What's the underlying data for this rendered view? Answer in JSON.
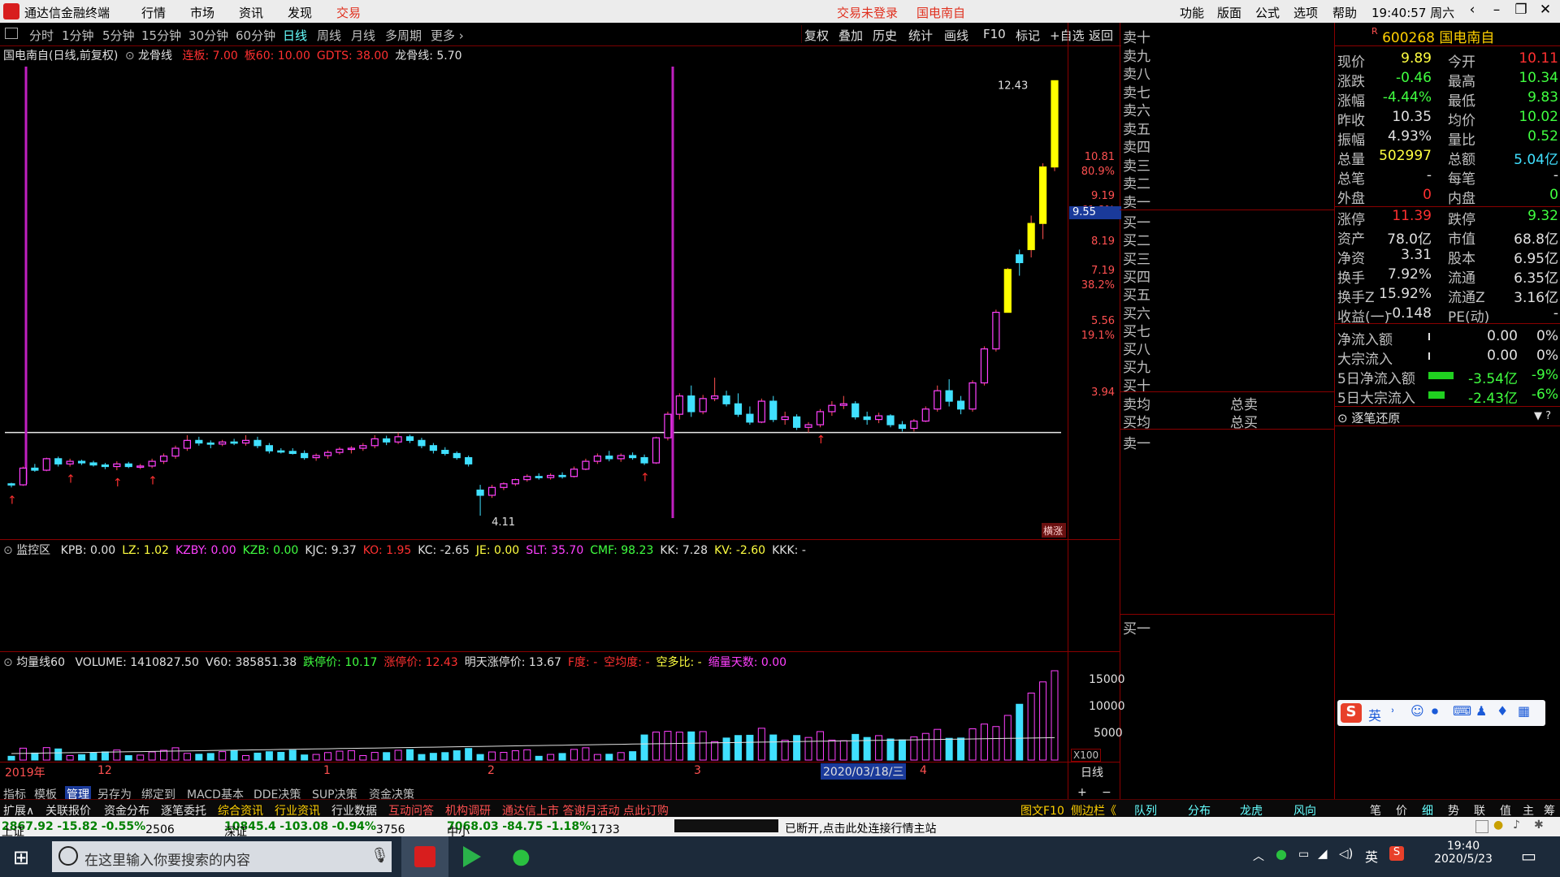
{
  "app": {
    "title": "通达信金融终端",
    "menu": [
      "行情",
      "市场",
      "资讯",
      "发现",
      "交易"
    ],
    "trade_status": "交易未登录",
    "stock_short": "国电南自",
    "right_menu": [
      "功能",
      "版面",
      "公式",
      "选项",
      "帮助"
    ],
    "clock": "19:40:57",
    "weekday": "周六"
  },
  "period_bar": {
    "periods": [
      "分时",
      "1分钟",
      "5分钟",
      "15分钟",
      "30分钟",
      "60分钟",
      "日线",
      "周线",
      "月线",
      "多周期",
      "更多"
    ],
    "active": "日线",
    "tools": [
      "复权",
      "叠加",
      "历史",
      "统计",
      "画线",
      "F10",
      "标记",
      "+自选",
      "返回"
    ]
  },
  "main_chart": {
    "header_name": "国电南自(日线,前复权)",
    "indicator_name": "龙骨线",
    "params": [
      {
        "k": "连板",
        "v": "7.00",
        "color": "#ff3030"
      },
      {
        "k": "板60",
        "v": "10.00",
        "color": "#ff3030"
      },
      {
        "k": "GDTS",
        "v": "38.00",
        "color": "#ff3030"
      },
      {
        "k": "龙骨线",
        "v": "5.70",
        "color": "#e0e0e0"
      }
    ],
    "price_labels": [
      "10.81",
      "80.9%",
      "9.19",
      "61.8%",
      "8.19",
      "7.19",
      "38.2%",
      "5.56",
      "19.1%",
      "3.94"
    ],
    "current_price_tag": "9.55",
    "high_label": "12.43",
    "low_label": "4.11",
    "badge": "横涨"
  },
  "chart_data": {
    "type": "candlestick",
    "y_range": [
      3.94,
      12.7
    ],
    "support_line": 5.7,
    "candles": [
      [
        4.72,
        4.74,
        4.65,
        4.7
      ],
      [
        4.7,
        5.05,
        4.68,
        5.02
      ],
      [
        5.02,
        5.1,
        4.95,
        4.98
      ],
      [
        4.98,
        5.22,
        4.96,
        5.2
      ],
      [
        5.2,
        5.24,
        5.05,
        5.1
      ],
      [
        5.1,
        5.2,
        5.05,
        5.15
      ],
      [
        5.15,
        5.18,
        5.08,
        5.12
      ],
      [
        5.12,
        5.16,
        5.05,
        5.08
      ],
      [
        5.08,
        5.12,
        5.0,
        5.05
      ],
      [
        5.05,
        5.15,
        4.98,
        5.1
      ],
      [
        5.1,
        5.14,
        5.02,
        5.05
      ],
      [
        5.05,
        5.1,
        5.0,
        5.06
      ],
      [
        5.06,
        5.2,
        5.02,
        5.15
      ],
      [
        5.15,
        5.3,
        5.1,
        5.25
      ],
      [
        5.25,
        5.45,
        5.2,
        5.4
      ],
      [
        5.4,
        5.65,
        5.35,
        5.55
      ],
      [
        5.55,
        5.62,
        5.45,
        5.5
      ],
      [
        5.5,
        5.55,
        5.4,
        5.48
      ],
      [
        5.48,
        5.56,
        5.44,
        5.52
      ],
      [
        5.52,
        5.58,
        5.46,
        5.5
      ],
      [
        5.5,
        5.65,
        5.45,
        5.55
      ],
      [
        5.55,
        5.62,
        5.4,
        5.45
      ],
      [
        5.45,
        5.5,
        5.3,
        5.35
      ],
      [
        5.35,
        5.4,
        5.3,
        5.34
      ],
      [
        5.34,
        5.4,
        5.28,
        5.3
      ],
      [
        5.3,
        5.36,
        5.18,
        5.22
      ],
      [
        5.22,
        5.3,
        5.16,
        5.26
      ],
      [
        5.26,
        5.36,
        5.2,
        5.32
      ],
      [
        5.32,
        5.42,
        5.28,
        5.38
      ],
      [
        5.38,
        5.44,
        5.3,
        5.4
      ],
      [
        5.4,
        5.5,
        5.35,
        5.45
      ],
      [
        5.45,
        5.65,
        5.4,
        5.58
      ],
      [
        5.58,
        5.64,
        5.46,
        5.52
      ],
      [
        5.52,
        5.7,
        5.48,
        5.62
      ],
      [
        5.62,
        5.66,
        5.5,
        5.55
      ],
      [
        5.55,
        5.6,
        5.4,
        5.45
      ],
      [
        5.45,
        5.5,
        5.3,
        5.36
      ],
      [
        5.36,
        5.42,
        5.26,
        5.3
      ],
      [
        5.3,
        5.34,
        5.18,
        5.22
      ],
      [
        5.22,
        5.26,
        5.05,
        5.1
      ],
      [
        4.6,
        4.7,
        4.11,
        4.5
      ],
      [
        4.5,
        4.7,
        4.45,
        4.65
      ],
      [
        4.65,
        4.75,
        4.6,
        4.72
      ],
      [
        4.72,
        4.82,
        4.68,
        4.8
      ],
      [
        4.8,
        4.9,
        4.76,
        4.86
      ],
      [
        4.86,
        4.92,
        4.8,
        4.84
      ],
      [
        4.84,
        4.92,
        4.8,
        4.88
      ],
      [
        4.88,
        4.94,
        4.82,
        4.86
      ],
      [
        4.86,
        5.05,
        4.84,
        5.0
      ],
      [
        5.0,
        5.2,
        4.98,
        5.15
      ],
      [
        5.15,
        5.3,
        5.1,
        5.25
      ],
      [
        5.25,
        5.35,
        5.15,
        5.2
      ],
      [
        5.2,
        5.3,
        5.14,
        5.26
      ],
      [
        5.26,
        5.32,
        5.18,
        5.22
      ],
      [
        5.22,
        5.28,
        5.08,
        5.12
      ],
      [
        5.12,
        5.62,
        5.1,
        5.6
      ],
      [
        5.6,
        6.1,
        5.55,
        6.05
      ],
      [
        6.05,
        6.45,
        5.95,
        6.4
      ],
      [
        6.4,
        6.6,
        6.0,
        6.1
      ],
      [
        6.1,
        6.42,
        6.05,
        6.35
      ],
      [
        6.35,
        6.75,
        6.3,
        6.4
      ],
      [
        6.4,
        6.5,
        6.2,
        6.25
      ],
      [
        6.25,
        6.45,
        6.0,
        6.05
      ],
      [
        6.05,
        6.2,
        5.85,
        5.9
      ],
      [
        5.9,
        6.35,
        5.88,
        6.3
      ],
      [
        6.3,
        6.4,
        5.9,
        5.95
      ],
      [
        5.95,
        6.1,
        5.85,
        6.0
      ],
      [
        6.0,
        6.05,
        5.75,
        5.8
      ],
      [
        5.8,
        5.9,
        5.7,
        5.85
      ],
      [
        5.85,
        6.15,
        5.8,
        6.1
      ],
      [
        6.1,
        6.3,
        6.02,
        6.22
      ],
      [
        6.22,
        6.4,
        6.15,
        6.25
      ],
      [
        6.25,
        6.3,
        5.95,
        6.0
      ],
      [
        6.0,
        6.1,
        5.85,
        5.95
      ],
      [
        5.95,
        6.08,
        5.88,
        6.02
      ],
      [
        6.02,
        6.05,
        5.8,
        5.85
      ],
      [
        5.85,
        5.92,
        5.72,
        5.78
      ],
      [
        5.78,
        5.96,
        5.72,
        5.92
      ],
      [
        5.92,
        6.2,
        5.9,
        6.15
      ],
      [
        6.15,
        6.6,
        6.1,
        6.5
      ],
      [
        6.5,
        6.72,
        6.2,
        6.3
      ],
      [
        6.3,
        6.4,
        6.05,
        6.15
      ],
      [
        6.15,
        6.7,
        6.1,
        6.65
      ],
      [
        6.65,
        7.35,
        6.6,
        7.3
      ],
      [
        7.3,
        8.05,
        7.25,
        8.0
      ],
      [
        8.0,
        8.85,
        8.0,
        8.82
      ],
      [
        9.1,
        9.2,
        8.7,
        8.95
      ],
      [
        9.2,
        9.85,
        9.05,
        9.7
      ],
      [
        9.7,
        10.85,
        9.4,
        10.78
      ],
      [
        10.78,
        12.43,
        10.7,
        12.43
      ]
    ]
  },
  "monitor_pane": {
    "title": "监控区",
    "items": [
      {
        "k": "KPB",
        "v": "0.00",
        "color": "#e0e0e0"
      },
      {
        "k": "LZ",
        "v": "1.02",
        "color": "#ffff40"
      },
      {
        "k": "KZBY",
        "v": "0.00",
        "color": "#ff40ff"
      },
      {
        "k": "KZB",
        "v": "0.00",
        "color": "#40ff40"
      },
      {
        "k": "KJC",
        "v": "9.37",
        "color": "#e0e0e0"
      },
      {
        "k": "KO",
        "v": "1.95",
        "color": "#ff3030"
      },
      {
        "k": "KC",
        "v": "-2.65",
        "color": "#e0e0e0"
      },
      {
        "k": "JE",
        "v": "0.00",
        "color": "#ffff40"
      },
      {
        "k": "SLT",
        "v": "35.70",
        "color": "#ff40ff"
      },
      {
        "k": "CMF",
        "v": "98.23",
        "color": "#40ff40"
      },
      {
        "k": "KK",
        "v": "7.28",
        "color": "#e0e0e0"
      },
      {
        "k": "KV",
        "v": "-2.60",
        "color": "#ffff40"
      },
      {
        "k": "KKK",
        "v": "-",
        "color": "#e0e0e0"
      }
    ]
  },
  "volume_pane": {
    "title": "均量线60",
    "items": [
      {
        "k": "VOLUME",
        "v": "1410827.50",
        "color": "#e0e0e0"
      },
      {
        "k": "V60",
        "v": "385851.38",
        "color": "#e0e0e0"
      },
      {
        "k": "跌停价",
        "v": "10.17",
        "color": "#40ff40"
      },
      {
        "k": "涨停价",
        "v": "12.43",
        "color": "#ff3030"
      },
      {
        "k": "明天涨停价",
        "v": "13.67",
        "color": "#e0e0e0"
      },
      {
        "k": "F度",
        "v": "-",
        "color": "#ff3030"
      },
      {
        "k": "空均度",
        "v": "-",
        "color": "#ff3030"
      },
      {
        "k": "空多比",
        "v": "-",
        "color": "#ffff40"
      },
      {
        "k": "缩量天数",
        "v": "0.00",
        "color": "#ff40ff"
      }
    ],
    "y_labels": [
      "15000",
      "10000",
      "5000"
    ],
    "unit": "X100"
  },
  "time_axis": {
    "labels": [
      "2019年",
      "12",
      "1",
      "2",
      "3",
      "4"
    ],
    "cursor_date": "2020/03/18/三",
    "mode": "日线"
  },
  "bottom_tabs": [
    "指标",
    "模板",
    "管理",
    "另存为",
    "绑定到",
    "MACD基本",
    "DDE决策",
    "SUP决策",
    "资金决策"
  ],
  "ext_tabs": [
    "扩展∧",
    "关联报价",
    "资金分布",
    "逐笔委托",
    "综合资讯",
    "行业资讯",
    "行业数据",
    "互动问答",
    "机构调研",
    "通达信上市 答谢月活动 点此订购"
  ],
  "ext_right": [
    "图文F10",
    "侧边栏《"
  ],
  "right_tabs": [
    "队列",
    "分布",
    "龙虎",
    "风向"
  ],
  "far_right_tabs": [
    "笔",
    "价",
    "细",
    "势",
    "联",
    "值",
    "主",
    "筹"
  ],
  "orderbook": {
    "sells": [
      "卖十",
      "卖九",
      "卖八",
      "卖七",
      "卖六",
      "卖五",
      "卖四",
      "卖三",
      "卖二",
      "卖一"
    ],
    "buys": [
      "买一",
      "买二",
      "买三",
      "买四",
      "买五",
      "买六",
      "买七",
      "买八",
      "买九",
      "买十"
    ],
    "avg_sell": "卖均",
    "avg_buy": "买均",
    "total_sell": "总卖",
    "total_buy": "总买",
    "queue_sell": "卖一",
    "queue_buy": "买一"
  },
  "quote": {
    "code": "600268",
    "name": "国电南自",
    "rows": [
      {
        "k1": "现价",
        "v1": "9.89",
        "c1": "#ffff40",
        "k2": "今开",
        "v2": "10.11",
        "c2": "#ff3030"
      },
      {
        "k1": "涨跌",
        "v1": "-0.46",
        "c1": "#40ff40",
        "k2": "最高",
        "v2": "10.34",
        "c2": "#40ff40"
      },
      {
        "k1": "涨幅",
        "v1": "-4.44%",
        "c1": "#40ff40",
        "k2": "最低",
        "v2": "9.83",
        "c2": "#40ff40"
      },
      {
        "k1": "昨收",
        "v1": "10.35",
        "c1": "#e0e0e0",
        "k2": "均价",
        "v2": "10.02",
        "c2": "#40ff40"
      },
      {
        "k1": "振幅",
        "v1": "4.93%",
        "c1": "#e0e0e0",
        "k2": "量比",
        "v2": "0.52",
        "c2": "#40ff40"
      },
      {
        "k1": "总量",
        "v1": "502997",
        "c1": "#ffff40",
        "k2": "总额",
        "v2": "5.04亿",
        "c2": "#40e0ff"
      },
      {
        "k1": "总笔",
        "v1": "-",
        "c1": "#e0e0e0",
        "k2": "每笔",
        "v2": "-",
        "c2": "#e0e0e0"
      },
      {
        "k1": "外盘",
        "v1": "0",
        "c1": "#ff3030",
        "k2": "内盘",
        "v2": "0",
        "c2": "#40ff40"
      }
    ],
    "rows2": [
      {
        "k1": "涨停",
        "v1": "11.39",
        "c1": "#ff3030",
        "k2": "跌停",
        "v2": "9.32",
        "c2": "#40ff40"
      },
      {
        "k1": "资产",
        "v1": "78.0亿",
        "c1": "#e0e0e0",
        "k2": "市值",
        "v2": "68.8亿",
        "c2": "#e0e0e0"
      },
      {
        "k1": "净资",
        "v1": "3.31",
        "c1": "#e0e0e0",
        "k2": "股本",
        "v2": "6.95亿",
        "c2": "#e0e0e0"
      },
      {
        "k1": "换手",
        "v1": "7.92%",
        "c1": "#e0e0e0",
        "k2": "流通",
        "v2": "6.35亿",
        "c2": "#e0e0e0"
      },
      {
        "k1": "换手Z",
        "v1": "15.92%",
        "c1": "#e0e0e0",
        "k2": "流通Z",
        "v2": "3.16亿",
        "c2": "#e0e0e0"
      },
      {
        "k1": "收益(一)",
        "v1": "-0.148",
        "c1": "#e0e0e0",
        "k2": "PE(动)",
        "v2": "-",
        "c2": "#e0e0e0"
      }
    ],
    "flows": [
      {
        "k": "净流入额",
        "v": "0.00",
        "p": "0%",
        "c": "#e0e0e0",
        "bar": 0
      },
      {
        "k": "大宗流入",
        "v": "0.00",
        "p": "0%",
        "c": "#e0e0e0",
        "bar": 0
      },
      {
        "k": "5日净流入额",
        "v": "-3.54亿",
        "p": "-9%",
        "c": "#40ff40",
        "bar": 0.9
      },
      {
        "k": "5日大宗流入",
        "v": "-2.43亿",
        "p": "-6%",
        "c": "#40ff40",
        "bar": 0.6
      }
    ],
    "tick_restore": "逐笔还原",
    "tick_icons": "▼ ?"
  },
  "status_bar": {
    "sh": {
      "name": "上证",
      "price": "2867.92",
      "chg": "-15.82",
      "pct": "-0.55%",
      "amt": "2506亿"
    },
    "sz": {
      "name": "深证",
      "price": "10845.4",
      "chg": "-103.08",
      "pct": "-0.94%",
      "amt": "3756亿"
    },
    "zx": {
      "name": "中小",
      "price": "7068.03",
      "chg": "-84.75",
      "pct": "-1.18%",
      "amt": "1733亿"
    },
    "msg": "已断开,点击此处连接行情主站"
  },
  "ime": {
    "lang": "英"
  },
  "taskbar": {
    "search_placeholder": "在这里输入你要搜索的内容",
    "tray_lang": "英",
    "time": "19:40",
    "date": "2020/5/23"
  }
}
